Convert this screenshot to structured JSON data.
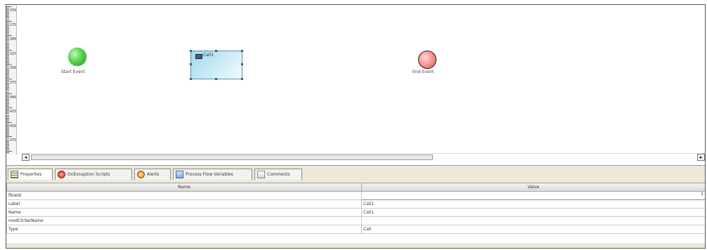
{
  "canvas": {
    "ruler_labels": [
      "250",
      "275",
      "300",
      "325",
      "350",
      "375",
      "400",
      "425",
      "450",
      "475"
    ],
    "start_event": {
      "label": "Start Event",
      "color": "#53d24a"
    },
    "call_task": {
      "label": "Call1"
    },
    "end_event": {
      "label": "End Event",
      "color": "#f08e88"
    }
  },
  "tabs": [
    {
      "label": "Properties",
      "icon": "properties-icon",
      "active": true
    },
    {
      "label": "OnException Scripts",
      "icon": "exception-icon",
      "active": false
    },
    {
      "label": "Alerts",
      "icon": "alert-icon",
      "active": false
    },
    {
      "label": "Process Flow Variables",
      "icon": "variables-icon",
      "active": false
    },
    {
      "label": "Comments",
      "icon": "comments-icon",
      "active": false
    }
  ],
  "properties": {
    "headers": {
      "name": "Name",
      "value": "Value"
    },
    "rows": [
      {
        "name": "flowId",
        "value": "",
        "trailing": "1"
      },
      {
        "name": "Label",
        "value": "Call1"
      },
      {
        "name": "Name",
        "value": "Call1"
      },
      {
        "name": "modCtrVarName",
        "value": ""
      },
      {
        "name": "Type",
        "value": "Call"
      }
    ]
  },
  "colors": {
    "window_border": "#555555",
    "tabbar_bg": "#ece9d8",
    "task_fill": "#9ed8ec"
  }
}
